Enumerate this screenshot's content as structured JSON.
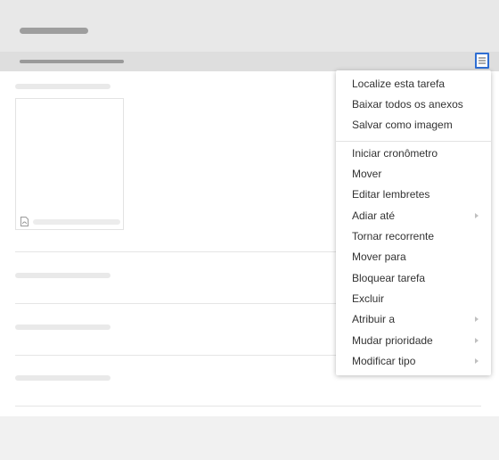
{
  "colors": {
    "accent": "#2f6ed3",
    "header_bg": "#e8e8e8",
    "subbar_bg": "#dedede",
    "menu_text": "#333333",
    "placeholder": "#e9e9e9"
  },
  "toolbar": {
    "menu_button_icon": "hamburger-menu-icon"
  },
  "attachment": {
    "icon": "pdf-file-icon"
  },
  "context_menu": {
    "group1": [
      {
        "label": "Localize esta tarefa"
      },
      {
        "label": "Baixar todos os anexos"
      },
      {
        "label": "Salvar como imagem"
      }
    ],
    "group2": [
      {
        "label": "Iniciar cronômetro",
        "submenu": false
      },
      {
        "label": "Mover",
        "submenu": false
      },
      {
        "label": "Editar lembretes",
        "submenu": false
      },
      {
        "label": "Adiar até",
        "submenu": true
      },
      {
        "label": "Tornar recorrente",
        "submenu": false
      },
      {
        "label": "Mover para",
        "submenu": false
      },
      {
        "label": "Bloquear tarefa",
        "submenu": false
      },
      {
        "label": "Excluir",
        "submenu": false
      },
      {
        "label": "Atribuir a",
        "submenu": true
      },
      {
        "label": "Mudar prioridade",
        "submenu": true
      },
      {
        "label": "Modificar tipo",
        "submenu": true
      }
    ]
  }
}
